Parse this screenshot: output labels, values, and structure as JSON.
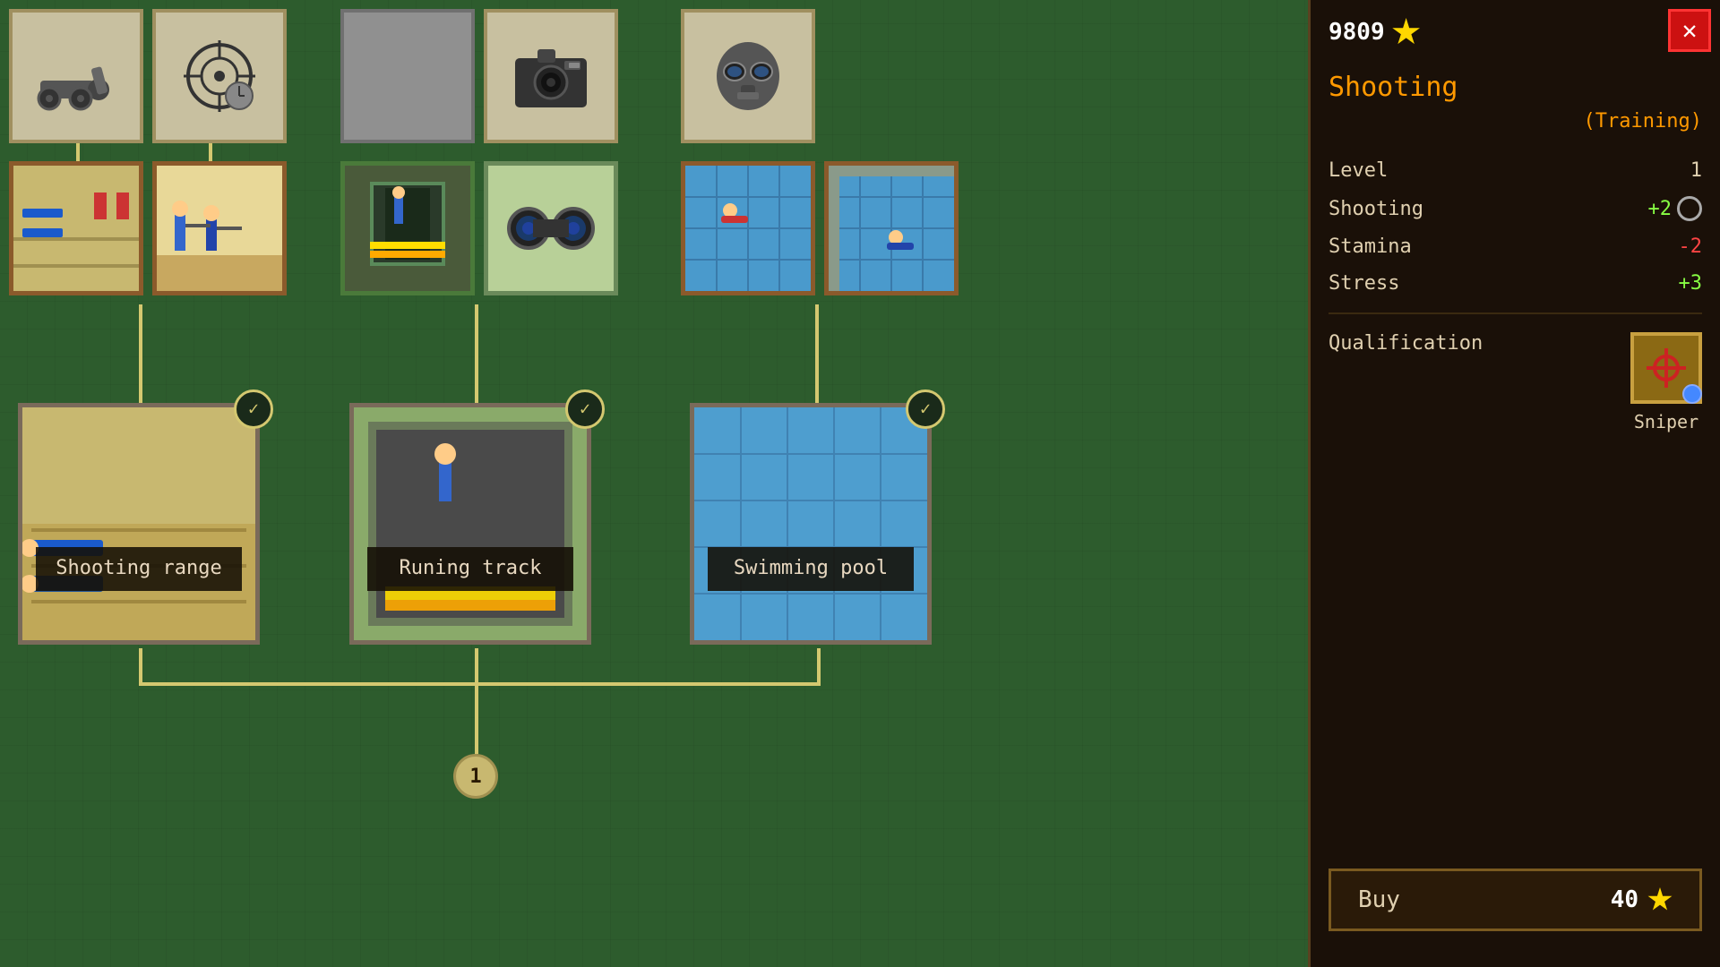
{
  "currency": {
    "amount": "9809",
    "icon": "star"
  },
  "panel": {
    "close_label": "✕",
    "title": "Shooting",
    "subtitle": "(Training)",
    "stats": {
      "level_label": "Level",
      "level_value": "1",
      "shooting_label": "Shooting",
      "shooting_value": "+2",
      "stamina_label": "Stamina",
      "stamina_value": "-2",
      "stress_label": "Stress",
      "stress_value": "+3"
    },
    "qualification_label": "Qualification",
    "qualification_name": "Sniper",
    "buy_label": "Buy",
    "buy_price": "40"
  },
  "facilities": {
    "shooting_range_label": "Shooting range",
    "running_track_label": "Runing track",
    "swimming_pool_label": "Swimming pool"
  },
  "number_badge": "1",
  "top_row": {
    "icons": [
      "cannon",
      "sniper-target",
      "empty",
      "camera",
      "gas-mask"
    ]
  }
}
